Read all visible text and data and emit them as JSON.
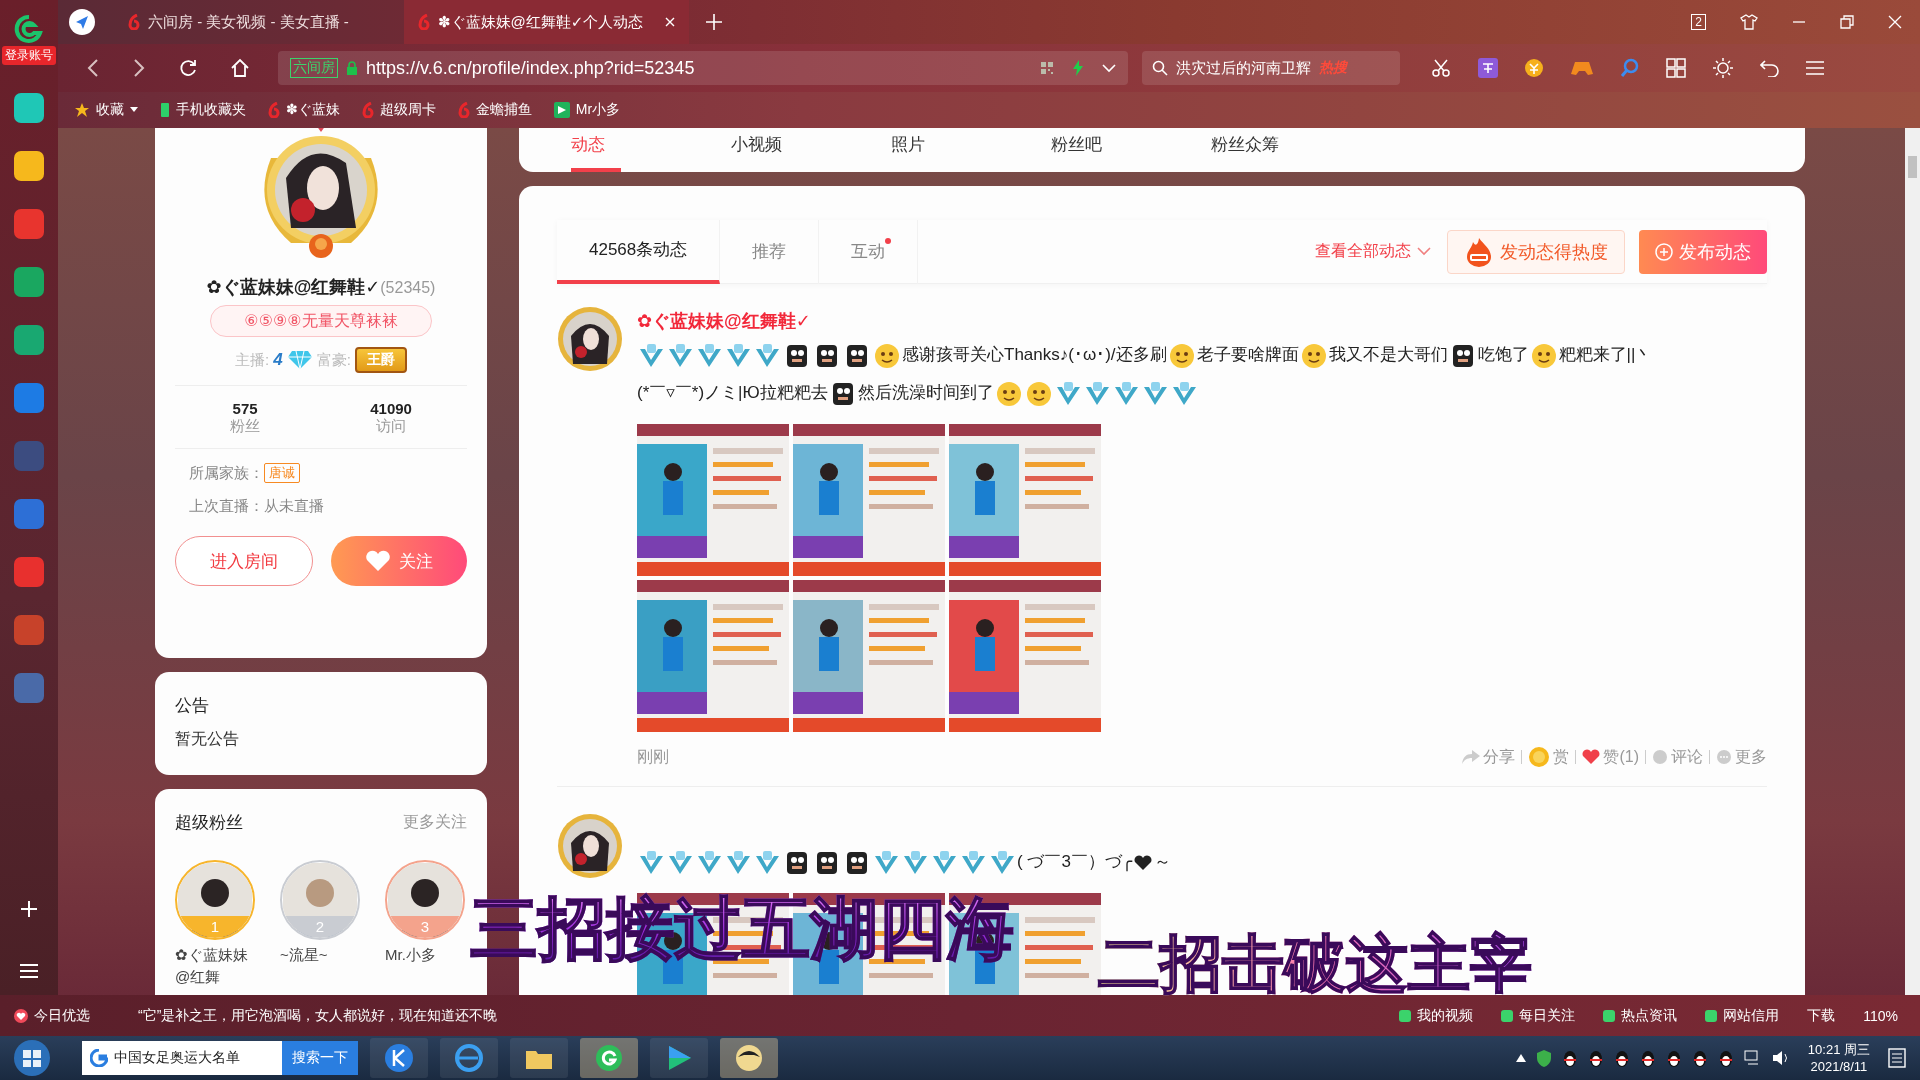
{
  "dock": {
    "login": "登录账号"
  },
  "browser_tabs": [
    {
      "label": "六间房 - 美女视频 - 美女直播 -",
      "selected": false
    },
    {
      "label": "✽ぐ蓝妹妹@红舞鞋✓个人动态",
      "selected": true
    }
  ],
  "window": {
    "tab_count": "2"
  },
  "address_bar": {
    "site_label": "六间房",
    "url": "https://v.6.cn/profile/index.php?rid=52345"
  },
  "search": {
    "value": "洪灾过后的河南卫辉",
    "tag": "热搜"
  },
  "bookmarks": [
    {
      "kind": "star",
      "label": "收藏"
    },
    {
      "kind": "phone",
      "label": "手机收藏夹"
    },
    {
      "kind": "site",
      "label": "✽ぐ蓝妹"
    },
    {
      "kind": "site",
      "label": "超级周卡"
    },
    {
      "kind": "site",
      "label": "金蟾捕鱼"
    },
    {
      "kind": "app",
      "label": "Mr小多"
    }
  ],
  "nav_tabs": [
    {
      "label": "动态",
      "selected": true
    },
    {
      "label": "小视频",
      "selected": false
    },
    {
      "label": "照片",
      "selected": false
    },
    {
      "label": "粉丝吧",
      "selected": false
    },
    {
      "label": "粉丝众筹",
      "selected": false
    }
  ],
  "profile": {
    "name": "✿ぐ蓝妹妹@红舞鞋✓",
    "id": "(52345)",
    "signature": "⑥⑤⑨⑧无量天尊袜袜",
    "anchor_label": "主播:",
    "anchor_level": "4",
    "rich_label": "富豪:",
    "rich_badge": "王爵",
    "stats": [
      {
        "value": "575",
        "label": "粉丝"
      },
      {
        "value": "41090",
        "label": "访问"
      }
    ],
    "family_label": "所属家族：",
    "family": "唐诚",
    "last_live": "上次直播：从未直播",
    "enter_button": "进入房间",
    "follow_button": "关注"
  },
  "notice": {
    "title": "公告",
    "text": "暂无公告"
  },
  "super_fans": {
    "title": "超级粉丝",
    "more": "更多关注",
    "fans": [
      {
        "rank": "1",
        "name": "✿ぐ蓝妹妹@红舞",
        "color": "#f7b52c"
      },
      {
        "rank": "2",
        "name": "~流星~",
        "color": "#c9ccd2"
      },
      {
        "rank": "3",
        "name": "Mr.小多",
        "color": "#f4a38c"
      }
    ]
  },
  "feed": {
    "tabs": [
      {
        "label": "42568条动态",
        "selected": true,
        "unread": false
      },
      {
        "label": "推荐",
        "selected": false,
        "unread": false
      },
      {
        "label": "互动",
        "selected": false,
        "unread": true
      }
    ],
    "view_all": "查看全部动态",
    "boost_button": "发动态得热度",
    "publish_button": "发布动态",
    "posts": [
      {
        "author": "✿ぐ蓝妹妹@红舞鞋✓",
        "content": [
          {
            "kind": "chevron"
          },
          {
            "kind": "chevron"
          },
          {
            "kind": "chevron"
          },
          {
            "kind": "chevron"
          },
          {
            "kind": "chevron"
          },
          {
            "kind": "sticker"
          },
          {
            "kind": "sticker"
          },
          {
            "kind": "sticker"
          },
          {
            "kind": "smiley"
          },
          {
            "kind": "text",
            "text": "感谢孩哥关心Thanks♪(･ω･)/还多刷"
          },
          {
            "kind": "smiley"
          },
          {
            "kind": "text",
            "text": "老子要啥牌面"
          },
          {
            "kind": "smiley"
          },
          {
            "kind": "text",
            "text": "我又不是大哥们"
          },
          {
            "kind": "sticker"
          },
          {
            "kind": "text",
            "text": "吃饱了"
          },
          {
            "kind": "smiley"
          },
          {
            "kind": "text",
            "text": "粑粑来了||丶"
          },
          {
            "kind": "break"
          },
          {
            "kind": "text",
            "text": "(*￣▿￣*)ノミ|Ю拉粑粑去"
          },
          {
            "kind": "sticker"
          },
          {
            "kind": "text",
            "text": "然后洗澡时间到了"
          },
          {
            "kind": "smiley"
          },
          {
            "kind": "smiley"
          },
          {
            "kind": "chevron"
          },
          {
            "kind": "chevron"
          },
          {
            "kind": "chevron"
          },
          {
            "kind": "chevron"
          },
          {
            "kind": "chevron"
          }
        ],
        "images": [
          {
            "kind": "picture"
          },
          {
            "kind": "picture"
          },
          {
            "kind": "picture"
          },
          {
            "kind": "picture"
          },
          {
            "kind": "picture"
          },
          {
            "kind": "picture"
          }
        ],
        "time": "刚刚",
        "actions": [
          {
            "kind": "share",
            "label": "分享"
          },
          {
            "kind": "reward",
            "label": "赏"
          },
          {
            "kind": "like",
            "label": "赞(1)"
          },
          {
            "kind": "comment",
            "label": "评论"
          },
          {
            "kind": "more",
            "label": "更多"
          }
        ]
      },
      {
        "content": [
          {
            "kind": "chevron"
          },
          {
            "kind": "chevron"
          },
          {
            "kind": "chevron"
          },
          {
            "kind": "chevron"
          },
          {
            "kind": "chevron"
          },
          {
            "kind": "sticker"
          },
          {
            "kind": "sticker"
          },
          {
            "kind": "sticker"
          },
          {
            "kind": "chevron"
          },
          {
            "kind": "chevron"
          },
          {
            "kind": "chevron"
          },
          {
            "kind": "chevron"
          },
          {
            "kind": "chevron"
          },
          {
            "kind": "text",
            "text": "( づ￣3￣）づ╭"
          },
          {
            "kind": "heart"
          },
          {
            "kind": "text",
            "text": "～"
          }
        ],
        "images": [
          {
            "kind": "picture"
          },
          {
            "kind": "picture"
          },
          {
            "kind": "picture"
          }
        ]
      }
    ]
  },
  "captions": [
    "三招接过五湖四海",
    "二招击破这主宰"
  ],
  "status_bar": {
    "left": "今日优选",
    "news": "“它”是补之王，用它泡酒喝，女人都说好，现在知道还不晚",
    "items": [
      "我的视频",
      "每日关注",
      "热点资讯",
      "网站信用"
    ],
    "download": "下载",
    "zoom": "110%"
  },
  "taskbar": {
    "search_value": "中国女足奥运大名单",
    "search_button": "搜索一下",
    "time": "10:21 周三",
    "date": "2021/8/11"
  }
}
